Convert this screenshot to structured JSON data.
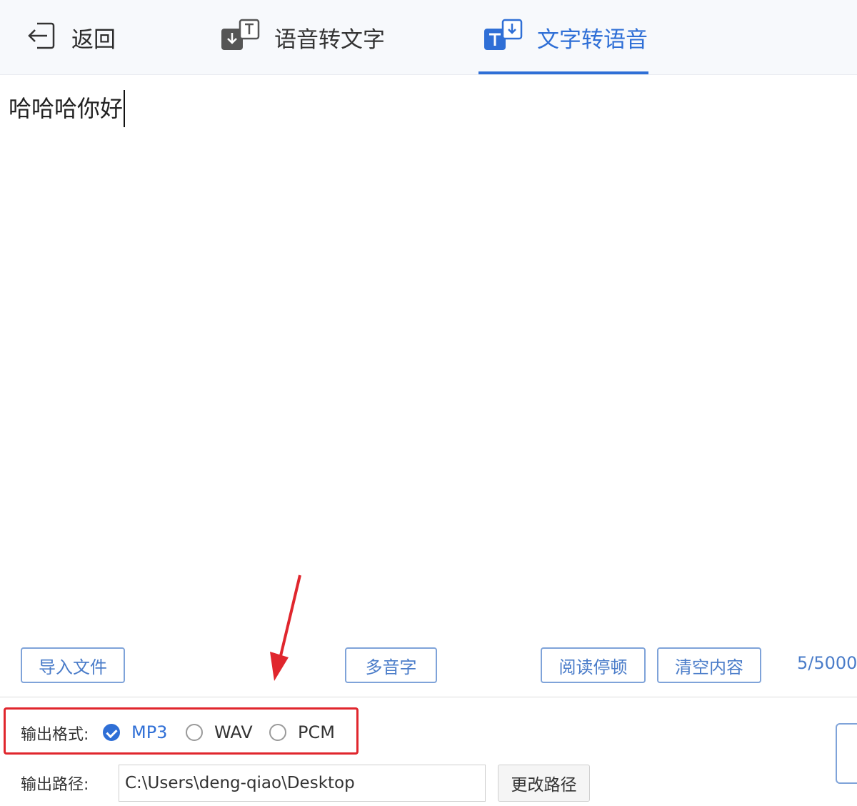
{
  "header": {
    "back_label": "返回",
    "tabs": [
      {
        "label": "语音转文字",
        "active": false
      },
      {
        "label": "文字转语音",
        "active": true
      }
    ]
  },
  "editor": {
    "text": "哈哈哈你好"
  },
  "toolbar": {
    "import_label": "导入文件",
    "polyphone_label": "多音字",
    "pause_label": "阅读停顿",
    "clear_label": "清空内容",
    "char_count": "5/5000"
  },
  "output": {
    "format_label": "输出格式:",
    "formats": [
      {
        "label": "MP3",
        "selected": true
      },
      {
        "label": "WAV",
        "selected": false
      },
      {
        "label": "PCM",
        "selected": false
      }
    ],
    "path_label": "输出路径:",
    "path_value": "C:\\Users\\deng-qiao\\Desktop",
    "change_path_label": "更改路径"
  },
  "colors": {
    "accent": "#2f6fd6",
    "button_border": "#7fa3d9",
    "highlight": "#e0262d"
  },
  "icons": {
    "back": "back-arrow-icon",
    "speech_to_text": "speech-to-text-icon",
    "text_to_speech": "text-to-speech-icon",
    "annotation_arrow": "red-arrow-annotation"
  }
}
